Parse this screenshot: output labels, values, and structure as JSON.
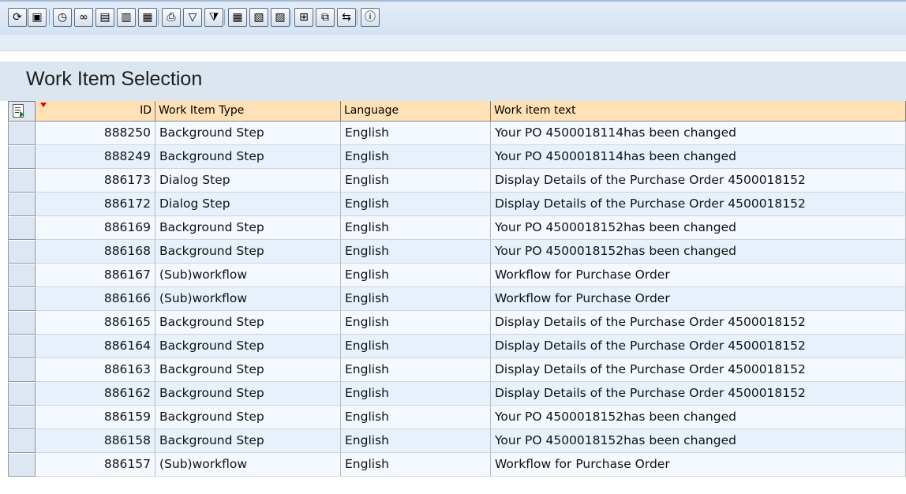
{
  "toolbar": {
    "buttons": [
      {
        "name": "refresh-icon",
        "glyph": "⟳"
      },
      {
        "name": "save-layout-icon",
        "glyph": "▣"
      },
      {
        "name": "clock-icon",
        "glyph": "◷"
      },
      {
        "name": "glasses-icon",
        "glyph": "∞"
      },
      {
        "name": "document-detail-icon",
        "glyph": "▤"
      },
      {
        "name": "attachment-icon",
        "glyph": "▥"
      },
      {
        "name": "clipboard-icon",
        "glyph": "▦"
      },
      {
        "name": "print-icon",
        "glyph": "⎙"
      },
      {
        "name": "sort-filter-icon",
        "glyph": "▽"
      },
      {
        "name": "filter-icon",
        "glyph": "⧩"
      },
      {
        "name": "grid-layout-icon",
        "glyph": "▦"
      },
      {
        "name": "add-column-icon",
        "glyph": "▧"
      },
      {
        "name": "remove-column-icon",
        "glyph": "▨"
      },
      {
        "name": "export-icon",
        "glyph": "⊞"
      },
      {
        "name": "spreadsheet-icon",
        "glyph": "⧉"
      },
      {
        "name": "transfer-icon",
        "glyph": "⇆"
      },
      {
        "name": "information-icon",
        "glyph": "ⓘ"
      }
    ]
  },
  "page": {
    "title": "Work Item Selection"
  },
  "table": {
    "columns": [
      "ID",
      "Work Item Type",
      "Language",
      "Work item text"
    ],
    "rows": [
      {
        "id": "888250",
        "type": "Background Step",
        "language": "English",
        "text": "Your PO 4500018114has been changed"
      },
      {
        "id": "888249",
        "type": "Background Step",
        "language": "English",
        "text": "Your PO 4500018114has been changed"
      },
      {
        "id": "886173",
        "type": "Dialog Step",
        "language": "English",
        "text": "Display Details of the Purchase Order 4500018152"
      },
      {
        "id": "886172",
        "type": "Dialog Step",
        "language": "English",
        "text": "Display Details of the Purchase Order 4500018152"
      },
      {
        "id": "886169",
        "type": "Background Step",
        "language": "English",
        "text": "Your PO 4500018152has been changed"
      },
      {
        "id": "886168",
        "type": "Background Step",
        "language": "English",
        "text": "Your PO 4500018152has been changed"
      },
      {
        "id": "886167",
        "type": "(Sub)workflow",
        "language": "English",
        "text": "Workflow for Purchase Order"
      },
      {
        "id": "886166",
        "type": "(Sub)workflow",
        "language": "English",
        "text": "Workflow for Purchase Order"
      },
      {
        "id": "886165",
        "type": "Background Step",
        "language": "English",
        "text": "Display Details of the Purchase Order 4500018152"
      },
      {
        "id": "886164",
        "type": "Background Step",
        "language": "English",
        "text": "Display Details of the Purchase Order 4500018152"
      },
      {
        "id": "886163",
        "type": "Background Step",
        "language": "English",
        "text": "Display Details of the Purchase Order 4500018152"
      },
      {
        "id": "886162",
        "type": "Background Step",
        "language": "English",
        "text": "Display Details of the Purchase Order 4500018152"
      },
      {
        "id": "886159",
        "type": "Background Step",
        "language": "English",
        "text": "Your PO 4500018152has been changed"
      },
      {
        "id": "886158",
        "type": "Background Step",
        "language": "English",
        "text": "Your PO 4500018152has been changed"
      },
      {
        "id": "886157",
        "type": "(Sub)workflow",
        "language": "English",
        "text": "Workflow for Purchase Order"
      }
    ]
  },
  "colors": {
    "header_bg": "#ffe1b5",
    "row_even": "#f3f9ff",
    "row_odd": "#e6f1fb",
    "title_bar": "#dce6f1",
    "toolbar_bg": "#d3e2f2"
  }
}
